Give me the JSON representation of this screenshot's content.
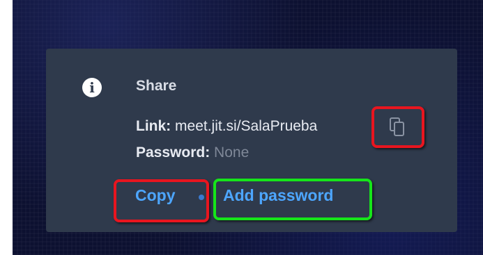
{
  "dialog": {
    "info_icon_glyph": "i",
    "title": "Share",
    "link_label": "Link:",
    "link_value": "meet.jit.si/SalaPrueba",
    "password_label": "Password:",
    "password_value": "None",
    "copy_icon": "copy-icon",
    "actions": {
      "copy_label": "Copy",
      "add_password_label": "Add password"
    }
  },
  "highlights": {
    "red": "#e8151f",
    "green": "#16e51a"
  },
  "colors": {
    "dialog_bg": "#2f3a4c",
    "link_color": "#4da6ff",
    "muted_text": "#7f8898"
  }
}
